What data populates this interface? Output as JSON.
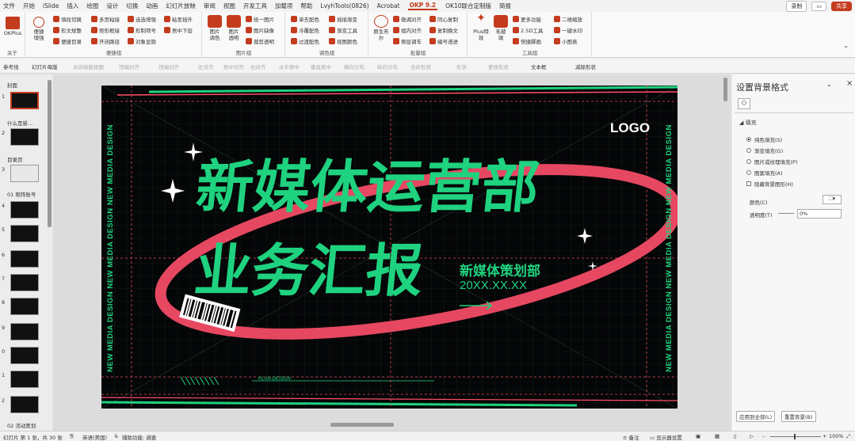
{
  "menu": {
    "items": [
      "文件",
      "开始",
      "iSlide",
      "插入",
      "绘图",
      "设计",
      "切换",
      "动画",
      "幻灯片放映",
      "审阅",
      "视图",
      "开发工具",
      "加载项",
      "帮助",
      "LvyhTools(0826)",
      "Acrobat",
      "OKP 9.2",
      "OK10联合定制版",
      "简报"
    ],
    "record": "录制",
    "share": "共享"
  },
  "ribbon": {
    "okplus": "OKPlus",
    "okplus_group": "关于",
    "g1": {
      "big": "便捷\n增强",
      "items": [
        "填段切换",
        "形文规整",
        "便捷目录",
        "多页粘接",
        "矩形框接",
        "开闭路径",
        "选选增强",
        "形制项号",
        "对象显隐",
        "粘至插外",
        "居中下层"
      ],
      "label": "便捷组"
    },
    "g2": {
      "items": [
        "图片\n调色",
        "图片\n透明",
        "统一图片",
        "图片缺像",
        "裁剪透明"
      ],
      "label": "图片组"
    },
    "g3": {
      "items": [
        "单去配色",
        "冷覆配色",
        "过渡配色",
        "插插渐变",
        "渐变工具",
        "视图颜色"
      ],
      "label": "调色组"
    },
    "g4": {
      "big": "原生布\n尔",
      "items": [
        "微调对齐",
        "组内对齐",
        "侧层调车",
        "同心复制",
        "复制换文",
        "编号递进"
      ],
      "label": "批量组"
    },
    "g5": {
      "items": [
        "Plus特\n效",
        "毛玻\n璃",
        "更多功能",
        "2.5D工具",
        "快捷脚画",
        "二维缩放",
        "一键水印",
        "小图表"
      ],
      "label": "工具组"
    }
  },
  "quickbar": [
    "参考线",
    "幻灯片母版",
    "关闭母版视图",
    "顶端对齐",
    "顶端对齐",
    "左对齐",
    "居中对齐",
    "右对齐",
    "水平居中",
    "垂直居中",
    "横向分布",
    "纵向分布",
    "合并形状",
    "形状",
    "更改形状",
    "文本框",
    "减除形状"
  ],
  "sidebar": {
    "sections": [
      "封面",
      "什么是新...",
      "目录页",
      "01 矩阵账号",
      "02 活动策划"
    ],
    "nums": [
      "1",
      "2",
      "3",
      "4",
      "5",
      "6",
      "7",
      "8",
      "9",
      "0",
      "1",
      "2"
    ]
  },
  "slide": {
    "logo": "LOGO",
    "title1": "新媒体运营部",
    "title2": "业务汇报",
    "dept": "新媒体策划部",
    "date": "20XX.XX.XX",
    "vertical": "NEW MEDIA DESIGN NEW MEDIA DESIGN NEW MEDIA DESIGN",
    "plan": "PLAN-DESIGN",
    "colors": {
      "green": "#1fd27f",
      "red": "#ff4f6b",
      "bg": "#050607"
    }
  },
  "pane": {
    "title": "设置背景格式",
    "section": "填充",
    "options": [
      "纯色填充(S)",
      "渐变填充(G)",
      "图片或纹理填充(P)",
      "图案填充(A)"
    ],
    "checkbox": "隐藏背景图形(H)",
    "color_label": "颜色(C)",
    "trans_label": "透明度(T)",
    "trans_value": "0%",
    "apply_all": "应用到全部(L)",
    "reset": "重置背景(B)"
  },
  "status": {
    "slide": "幻灯片 第 1 张，共 30 张",
    "lang": "英语(美国)",
    "access": "辅助功能: 调查",
    "notes": "备注",
    "display": "显示器设置",
    "zoom": "100%"
  }
}
